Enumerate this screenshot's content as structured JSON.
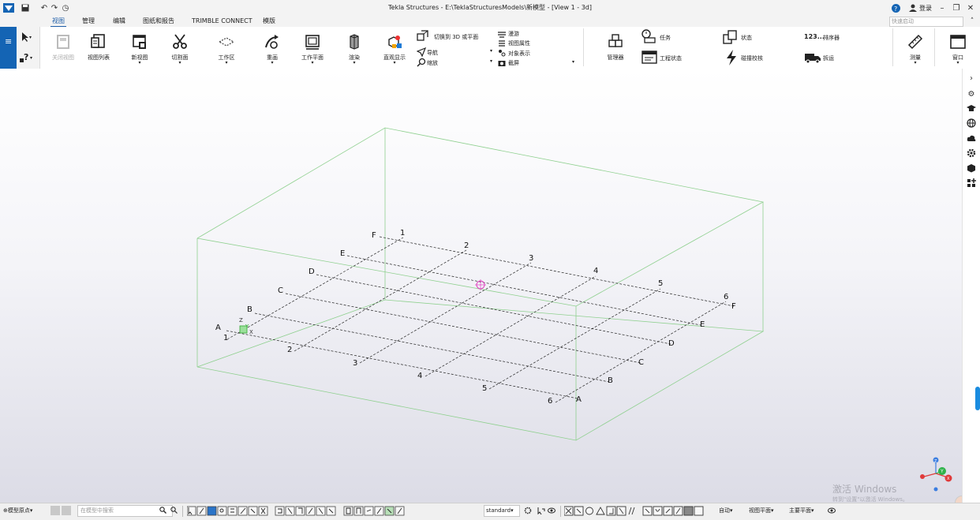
{
  "window": {
    "title": "Tekla Structures - E:\\TeklaStructuresModels\\新模型 - [View 1 - 3d]",
    "login_label": "登录",
    "help_icon": "help-icon",
    "minimize_icon": "minimize-icon",
    "maximize_icon": "maximize-icon",
    "close_icon": "close-icon"
  },
  "tabs": [
    "视图",
    "管理",
    "编辑",
    "图纸和报告",
    "TRIMBLE CONNECT",
    "模版"
  ],
  "active_tab": "视图",
  "quick_search": {
    "placeholder": "快速启动"
  },
  "ribbon": {
    "buttons": [
      {
        "label": "关闭视图",
        "icon": "close-view-icon",
        "disabled": true
      },
      {
        "label": "视图列表",
        "icon": "view-list-icon"
      },
      {
        "label": "新视图",
        "icon": "new-view-icon"
      },
      {
        "label": "切割面",
        "icon": "clip-plane-icon"
      },
      {
        "label": "工作区",
        "icon": "work-area-icon"
      },
      {
        "label": "重画",
        "icon": "redraw-icon"
      },
      {
        "label": "工作平面",
        "icon": "work-plane-icon"
      },
      {
        "label": "渲染",
        "icon": "rendering-icon"
      },
      {
        "label": "直观显示",
        "icon": "visualize-icon"
      }
    ],
    "small_items_a": [
      "切换到 3D 或平面",
      "导航",
      "缩放"
    ],
    "small_items_b": [
      "漫游",
      "视图属性",
      "对象表示",
      "截屏"
    ],
    "manager_label": "管理器",
    "tasks_label": "任务",
    "project_status_label": "工程状态",
    "status_label": "状态",
    "clash_check_label": "碰撞校核",
    "sequencer_prefix": "123...",
    "sequencer_label": "排序器",
    "unload_label": "拆运",
    "measure_label": "测量",
    "window_label": "窗口"
  },
  "viewport": {
    "grid_letters": [
      "A",
      "B",
      "C",
      "D",
      "E",
      "F"
    ],
    "grid_numbers": [
      "1",
      "2",
      "3",
      "4",
      "5",
      "6"
    ],
    "axis_x": "X",
    "axis_y": "Y",
    "axis_z": "Z",
    "origin_label": "Z"
  },
  "watermark": {
    "line1": "激活 Windows",
    "line2": "转到\"设置\"以激活 Windows。"
  },
  "statusbar": {
    "origin_dropdown": "模型原点",
    "search_placeholder": "在模型中搜索",
    "standard_dropdown": "standard",
    "auto_dropdown": "自动",
    "view_plane_dropdown": "视图平面",
    "main_plane_dropdown": "主要平面"
  },
  "colors": {
    "accent": "#1464b4",
    "bounding_box": "#8fd08f"
  }
}
